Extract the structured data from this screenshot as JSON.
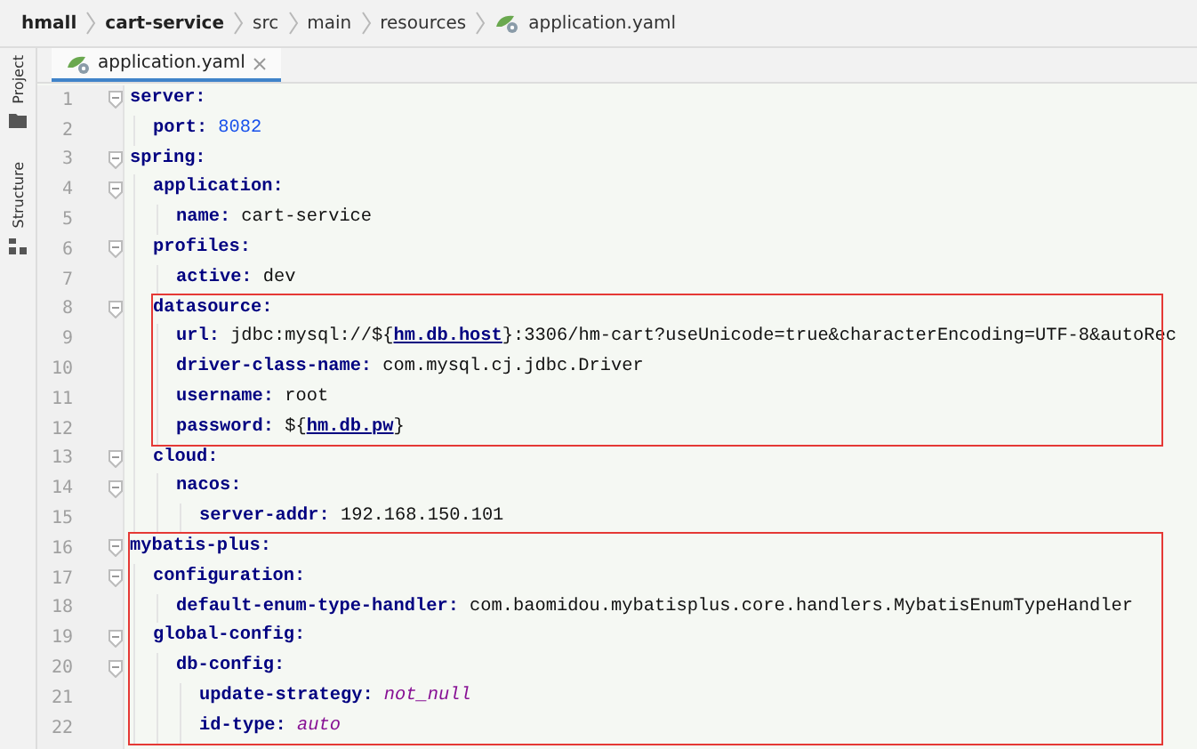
{
  "breadcrumb": [
    {
      "label": "hmall",
      "kind": "module"
    },
    {
      "label": "cart-service",
      "kind": "module"
    },
    {
      "label": "src",
      "kind": "folder"
    },
    {
      "label": "main",
      "kind": "folder"
    },
    {
      "label": "resources",
      "kind": "folder"
    },
    {
      "label": "application.yaml",
      "kind": "file"
    }
  ],
  "side_tabs": [
    {
      "label": "Project",
      "kind": "folder"
    },
    {
      "label": "Structure",
      "kind": "structure"
    }
  ],
  "tabs": [
    {
      "label": "application.yaml",
      "selected": true
    }
  ],
  "code": [
    {
      "line": "1",
      "key": "server:",
      "highlighted": false,
      "children": [
        {
          "line": "2",
          "key": "port:",
          "value": "8082",
          "kind": "number",
          "highlighted": false
        }
      ]
    },
    {
      "line": "3",
      "key": "spring:",
      "highlighted": false,
      "children": [
        {
          "line": "4",
          "key": "application:",
          "highlighted": false,
          "children": [
            {
              "line": "5",
              "key": "name:",
              "value": "cart-service",
              "kind": "text",
              "highlighted": false
            }
          ]
        },
        {
          "line": "6",
          "key": "profiles:",
          "highlighted": false,
          "children": [
            {
              "line": "7",
              "key": "active:",
              "value": "dev",
              "kind": "text",
              "highlighted": false
            }
          ]
        },
        {
          "line": "8",
          "key": "datasource:",
          "highlighted": true,
          "children": [
            {
              "line": "9",
              "key": "url:",
              "value": "jdbc:mysql://${**hm.db.host**}:3306/hm-cart?useUnicode=true&characterEncoding=UTF-8&autoRec",
              "kind": "text",
              "highlighted": false
            },
            {
              "line": "10",
              "key": "driver-class-name:",
              "value": "com.mysql.cj.jdbc.Driver",
              "kind": "text",
              "highlighted": false
            },
            {
              "line": "11",
              "key": "username:",
              "value": "root",
              "kind": "text",
              "highlighted": false
            },
            {
              "line": "12",
              "key": "password:",
              "value": "${**hm.db.pw**}",
              "kind": "text",
              "highlighted": false
            }
          ]
        },
        {
          "line": "13",
          "key": "cloud:",
          "highlighted": false,
          "children": [
            {
              "line": "14",
              "key": "nacos:",
              "highlighted": false,
              "children": [
                {
                  "line": "15",
                  "key": "server-addr:",
                  "value": "192.168.150.101",
                  "kind": "text",
                  "highlighted": false
                }
              ]
            }
          ]
        }
      ]
    },
    {
      "line": "16",
      "key": "mybatis-plus:",
      "highlighted": true,
      "children": [
        {
          "line": "17",
          "key": "configuration:",
          "highlighted": false,
          "children": [
            {
              "line": "18",
              "key": "default-enum-type-handler:",
              "value": "com.baomidou.mybatisplus.core.handlers.MybatisEnumTypeHandler",
              "kind": "text",
              "highlighted": false
            }
          ]
        },
        {
          "line": "19",
          "key": "global-config:",
          "highlighted": false,
          "children": [
            {
              "line": "20",
              "key": "db-config:",
              "highlighted": false,
              "children": [
                {
                  "line": "21",
                  "key": "update-strategy:",
                  "value": "not_null",
                  "kind": "keyword",
                  "highlighted": false
                },
                {
                  "line": "22",
                  "key": "id-type:",
                  "value": "auto",
                  "kind": "keyword",
                  "highlighted": false
                }
              ]
            }
          ]
        }
      ]
    }
  ]
}
